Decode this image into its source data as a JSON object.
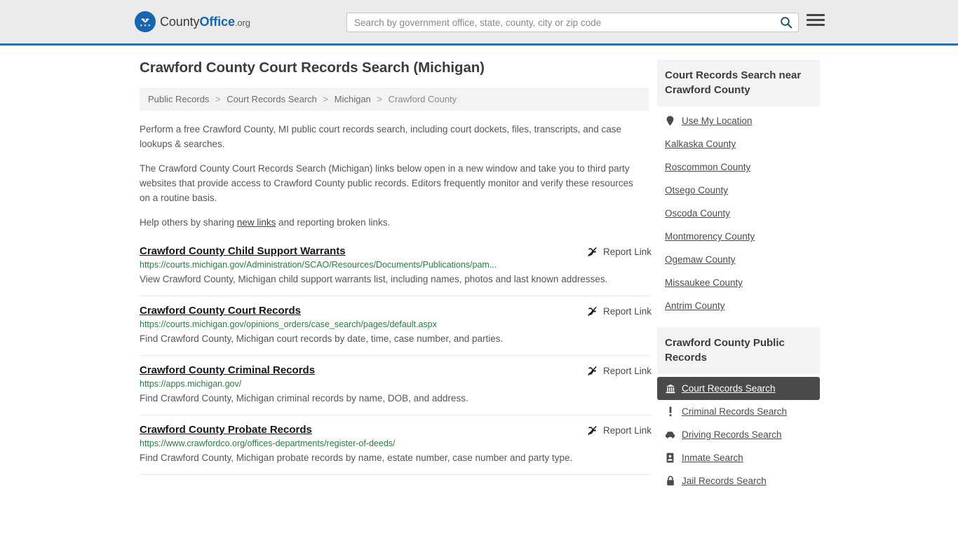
{
  "header": {
    "logo": {
      "prefix": "County",
      "bold": "Office",
      "tld": ".org",
      "icon": "eagle-badge-icon"
    },
    "search": {
      "placeholder": "Search by government office, state, county, city or zip code",
      "value": "",
      "button_icon": "search-icon"
    },
    "menu_icon": "hamburger-menu-icon",
    "accent_color": "#336f9e",
    "background_color": "#ebebeb"
  },
  "main": {
    "title": "Crawford County Court Records Search (Michigan)",
    "breadcrumb": [
      {
        "label": "Public Records",
        "current": false
      },
      {
        "label": "Court Records Search",
        "current": false
      },
      {
        "label": "Michigan",
        "current": false
      },
      {
        "label": "Crawford County",
        "current": true
      }
    ],
    "breadcrumb_separator": ">",
    "intro": {
      "paragraph1": "Perform a free Crawford County, MI public court records search, including court dockets, files, transcripts, and case lookups & searches.",
      "paragraph2": "The Crawford County Court Records Search (Michigan) links below open in a new window and take you to third party websites that provide access to Crawford County public records. Editors frequently monitor and verify these resources on a routine basis.",
      "paragraph3_before": "Help others by sharing ",
      "paragraph3_link": "new links",
      "paragraph3_after": " and reporting broken links."
    },
    "report_link_label": "Report Link",
    "report_link_icon": "broken-link-icon",
    "results": [
      {
        "title": "Crawford County Child Support Warrants",
        "url": "https://courts.michigan.gov/Administration/SCAO/Resources/Documents/Publications/pam...",
        "description": "View Crawford County, Michigan child support warrants list, including names, photos and last known addresses."
      },
      {
        "title": "Crawford County Court Records",
        "url": "https://courts.michigan.gov/opinions_orders/case_search/pages/default.aspx",
        "description": "Find Crawford County, Michigan court records by date, time, case number, and parties."
      },
      {
        "title": "Crawford County Criminal Records",
        "url": "https://apps.michigan.gov/",
        "description": "Find Crawford County, Michigan criminal records by name, DOB, and address."
      },
      {
        "title": "Crawford County Probate Records",
        "url": "https://www.crawfordco.org/offices-departments/register-of-deeds/",
        "description": "Find Crawford County, Michigan probate records by name, estate number, case number and party type."
      }
    ]
  },
  "sidebar": {
    "nearby_panel": {
      "heading": "Court Records Search near Crawford County",
      "items": [
        {
          "label": "Use My Location",
          "icon": "map-pin-icon"
        },
        {
          "label": "Kalkaska County",
          "icon": null
        },
        {
          "label": "Roscommon County",
          "icon": null
        },
        {
          "label": "Otsego County",
          "icon": null
        },
        {
          "label": "Oscoda County",
          "icon": null
        },
        {
          "label": "Montmorency County",
          "icon": null
        },
        {
          "label": "Ogemaw County",
          "icon": null
        },
        {
          "label": "Missaukee County",
          "icon": null
        },
        {
          "label": "Antrim County",
          "icon": null
        }
      ]
    },
    "records_panel": {
      "heading": "Crawford County Public Records",
      "items": [
        {
          "label": "Court Records Search",
          "icon": "courthouse-icon",
          "active": true
        },
        {
          "label": "Criminal Records Search",
          "icon": "exclamation-icon",
          "active": false
        },
        {
          "label": "Driving Records Search",
          "icon": "car-icon",
          "active": false
        },
        {
          "label": "Inmate Search",
          "icon": "id-badge-icon",
          "active": false
        },
        {
          "label": "Jail Records Search",
          "icon": "lock-icon",
          "active": false
        }
      ],
      "active_background": "#4a4a4a"
    }
  }
}
